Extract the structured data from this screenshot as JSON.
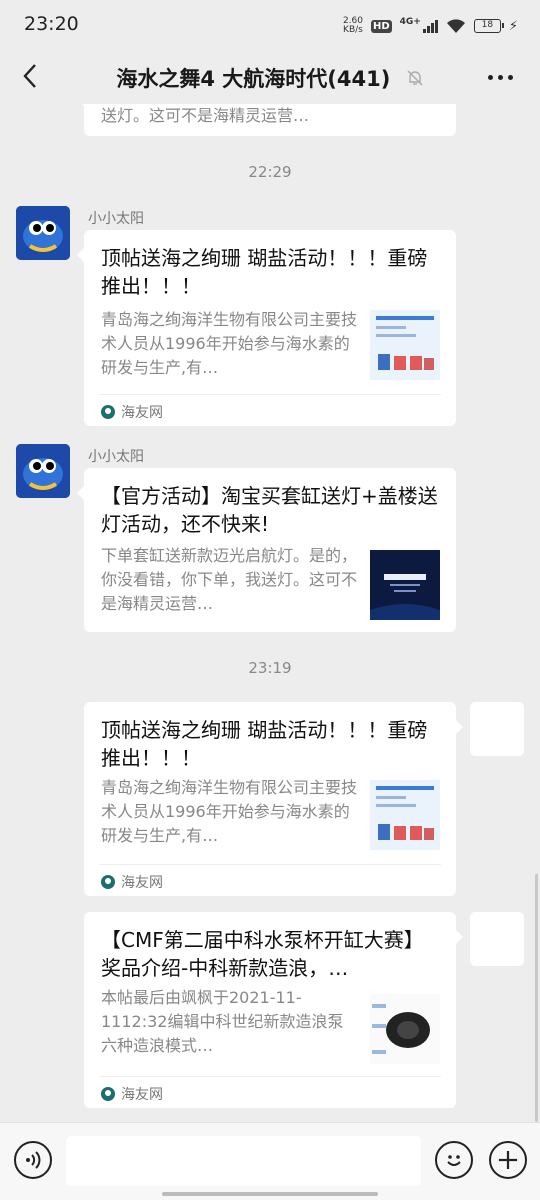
{
  "status_bar": {
    "time": "23:20",
    "speed_value": "2.60",
    "speed_unit": "KB/s",
    "hd": "HD",
    "network": "4G+",
    "battery": "18"
  },
  "header": {
    "title": "海水之舞4 大航海时代(441)",
    "back_icon": "chevron-left-icon",
    "mute_icon": "bell-off-icon",
    "more_icon": "more-dots-icon"
  },
  "messages": {
    "partial_top": {
      "desc_tail": "送灯。这可不是海精灵运营…"
    },
    "time_1": "22:29",
    "msg1": {
      "sender": "小小太阳",
      "title": "顶帖送海之绚珊 瑚盐活动！！！重磅推出！！！",
      "desc": "青岛海之绚海洋生物有限公司主要技术人员从1996年开始参与海水素的研发与生产,有…",
      "source": "海友网"
    },
    "msg2": {
      "sender": "小小太阳",
      "title": "【官方活动】淘宝买套缸送灯+盖楼送灯活动，还不快来!",
      "desc": "下单套缸送新款迈光启航灯。是的，你没看错，你下单，我送灯。这可不是海精灵运营…"
    },
    "time_2": "23:19",
    "msg3": {
      "title": "顶帖送海之绚珊 瑚盐活动！！！重磅推出！！！",
      "desc": "青岛海之绚海洋生物有限公司主要技术人员从1996年开始参与海水素的研发与生产,有…",
      "source": "海友网"
    },
    "msg4": {
      "title": "【CMF第二届中科水泵杯开缸大赛】奖品介绍-中科新款造浪，…",
      "desc": "本帖最后由飒枫于2021-11-1112:32编辑中科世纪新款造浪泵六种造浪模式…",
      "source": "海友网"
    }
  },
  "input_bar": {
    "voice_icon": "voice-icon",
    "emoji_icon": "emoji-icon",
    "plus_icon": "plus-icon",
    "placeholder": ""
  }
}
